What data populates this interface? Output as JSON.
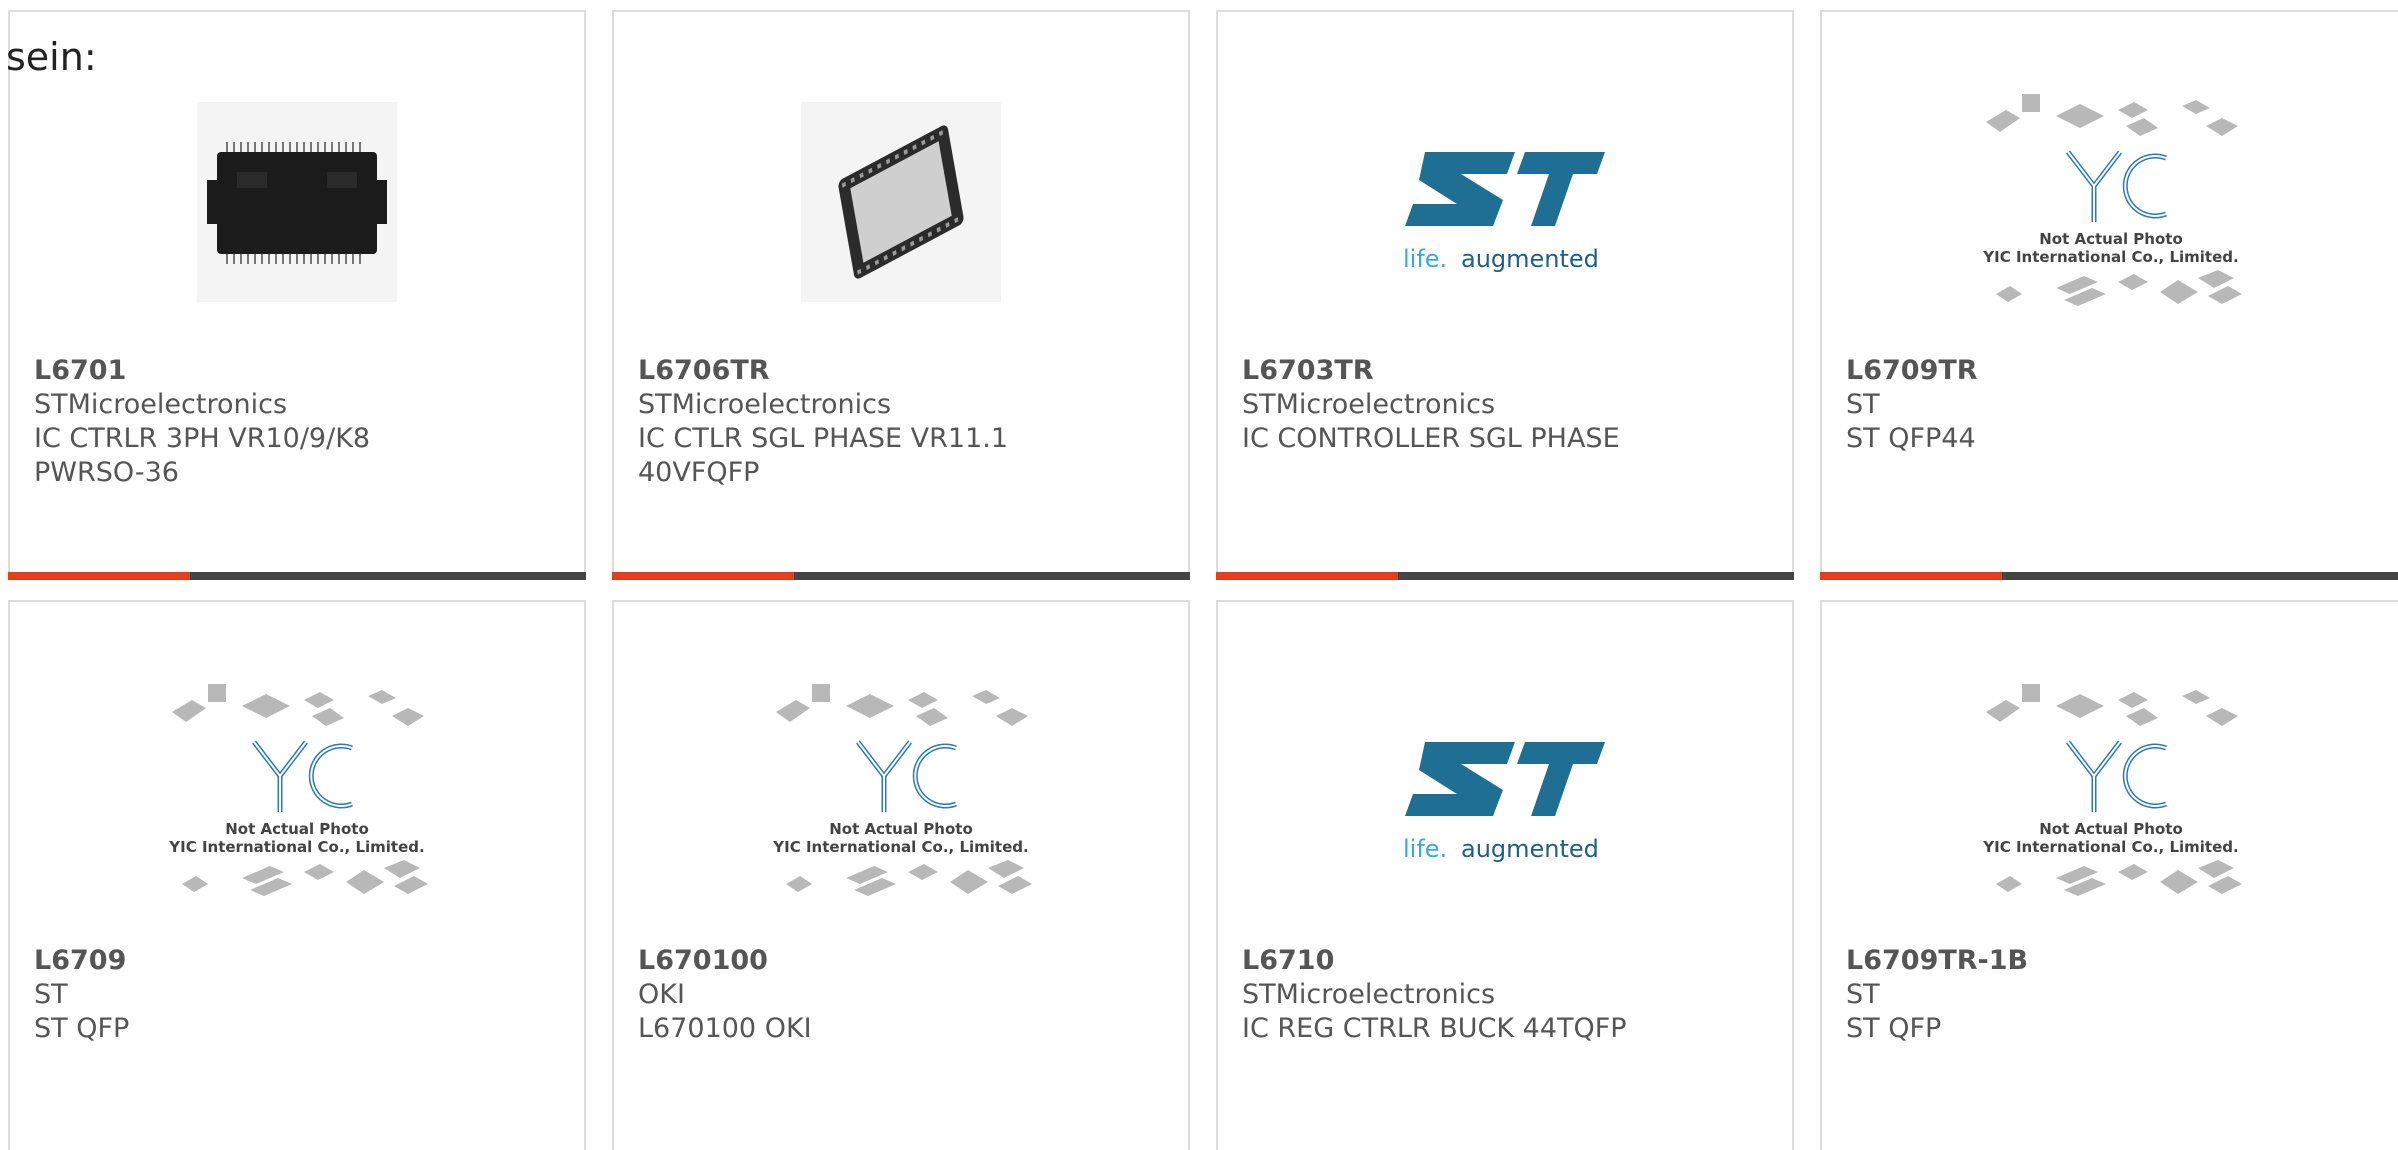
{
  "page": {
    "intro_text": "sein:"
  },
  "cards": [
    {
      "part_number": "L6701",
      "manufacturer": "STMicroelectronics",
      "description_line1": "IC CTRLR 3PH VR10/9/K8",
      "description_line2": "PWRSO-36",
      "image": "ic-package-photo"
    },
    {
      "part_number": "L6706TR",
      "manufacturer": "STMicroelectronics",
      "description_line1": "IC CTLR SGL PHASE VR11.1",
      "description_line2": "40VFQFP",
      "image": "qfn-chip-photo"
    },
    {
      "part_number": "L6703TR",
      "manufacturer": "STMicroelectronics",
      "description_line1": "IC CONTROLLER SGL PHASE",
      "description_line2": "",
      "image": "st-logo",
      "logo_tagline_1": "life.",
      "logo_tagline_2": "augmented"
    },
    {
      "part_number": "L6709TR",
      "manufacturer": "ST",
      "description_line1": "ST QFP44",
      "description_line2": "",
      "image": "yic-placeholder",
      "placeholder_line1": "Not Actual Photo",
      "placeholder_line2": "YIC International Co., Limited."
    },
    {
      "part_number": "L6709",
      "manufacturer": "ST",
      "description_line1": "ST QFP",
      "description_line2": "",
      "image": "yic-placeholder",
      "placeholder_line1": "Not Actual Photo",
      "placeholder_line2": "YIC International Co., Limited."
    },
    {
      "part_number": "L670100",
      "manufacturer": "OKI",
      "description_line1": "L670100 OKI",
      "description_line2": "",
      "image": "yic-placeholder",
      "placeholder_line1": "Not Actual Photo",
      "placeholder_line2": "YIC International Co., Limited."
    },
    {
      "part_number": "L6710",
      "manufacturer": "STMicroelectronics",
      "description_line1": "IC REG CTRLR BUCK 44TQFP",
      "description_line2": "",
      "image": "st-logo",
      "logo_tagline_1": "life.",
      "logo_tagline_2": "augmented"
    },
    {
      "part_number": "L6709TR-1B",
      "manufacturer": "ST",
      "description_line1": "ST QFP",
      "description_line2": "",
      "image": "yic-placeholder",
      "placeholder_line1": "Not Actual Photo",
      "placeholder_line2": "YIC International Co., Limited."
    }
  ],
  "colors": {
    "accent": "#e2401c",
    "bar_dark": "#444444",
    "st_blue": "#1f6f95",
    "st_light_blue": "#39a9dc",
    "yic_blue": "#2a78c2"
  }
}
